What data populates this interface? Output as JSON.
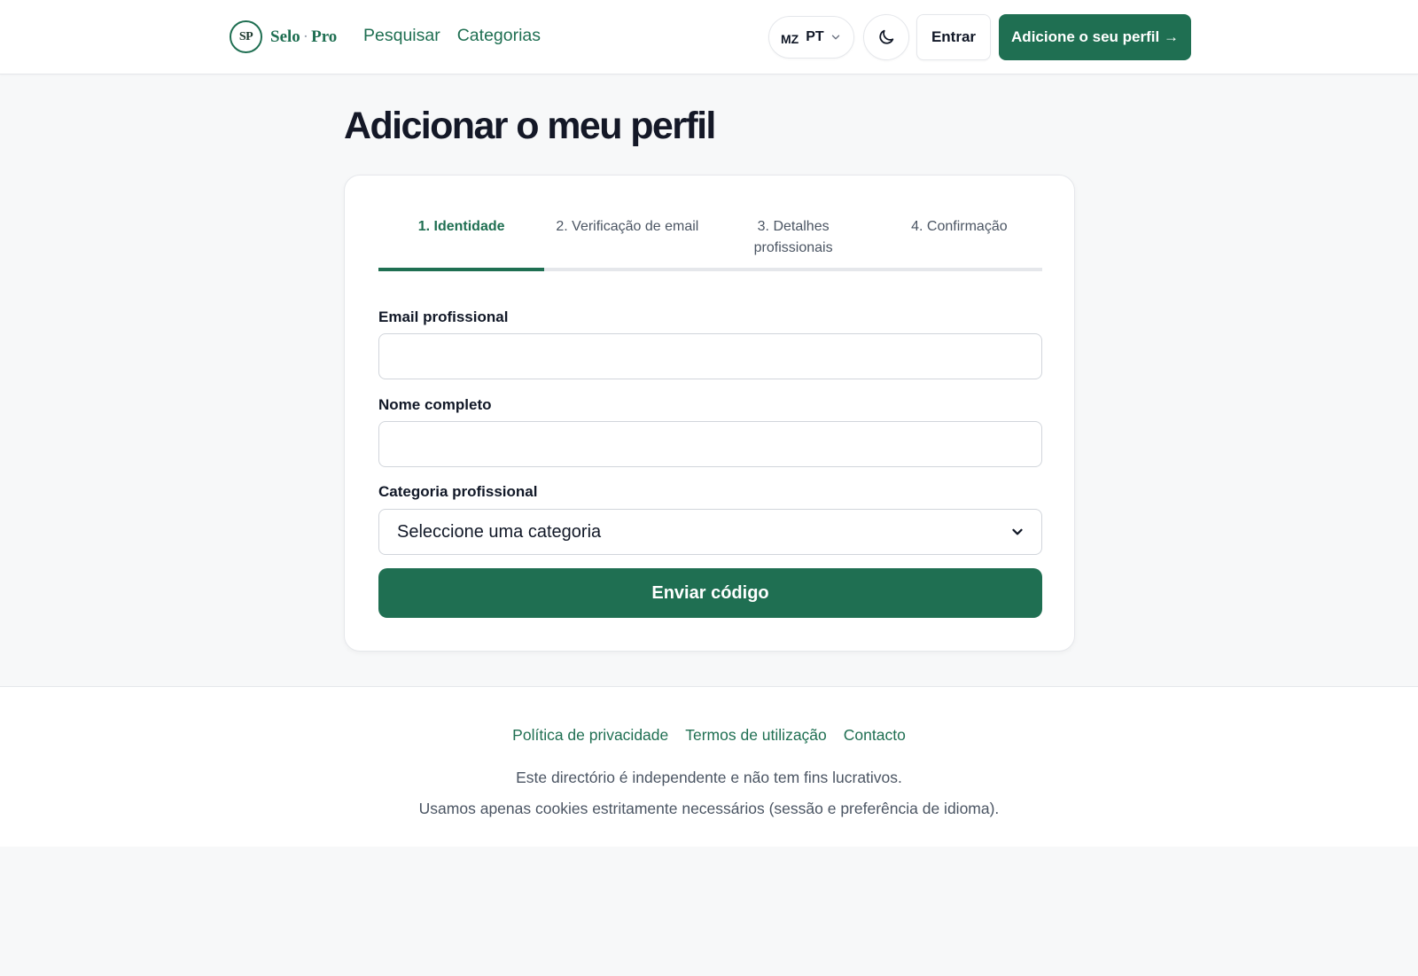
{
  "header": {
    "logo_mark": "SP",
    "logo_name_a": "Selo",
    "logo_sep": "·",
    "logo_name_b": "Pro",
    "nav": {
      "search": "Pesquisar",
      "categories": "Categorias"
    },
    "lang": {
      "country": "MZ",
      "code": "PT"
    },
    "login_label": "Entrar",
    "cta_label": "Adicione o seu perfil →"
  },
  "main": {
    "title": "Adicionar o meu perfil",
    "steps": [
      {
        "label": "1. Identidade",
        "active": true
      },
      {
        "label": "2. Verificação de email",
        "active": false
      },
      {
        "label": "3. Detalhes profissionais",
        "active": false
      },
      {
        "label": "4. Confirmação",
        "active": false
      }
    ],
    "form": {
      "email_label": "Email profissional",
      "email_value": "",
      "name_label": "Nome completo",
      "name_value": "",
      "category_label": "Categoria profissional",
      "category_selected": "Seleccione uma categoria",
      "submit_label": "Enviar código"
    }
  },
  "footer": {
    "links": {
      "privacy": "Política de privacidade",
      "terms": "Termos de utilização",
      "contact": "Contacto"
    },
    "note_1": "Este directório é independente e não tem fins lucrativos.",
    "note_2": "Usamos apenas cookies estritamente necessários (sessão e preferência de idioma)."
  },
  "colors": {
    "brand": "#1f6f52",
    "page_bg": "#f7f8f9",
    "border": "#e5e7eb"
  },
  "icons": {
    "theme_toggle": "moon-icon",
    "lang_dropdown": "chevron-down-icon",
    "select_dropdown": "chevron-down-icon"
  }
}
